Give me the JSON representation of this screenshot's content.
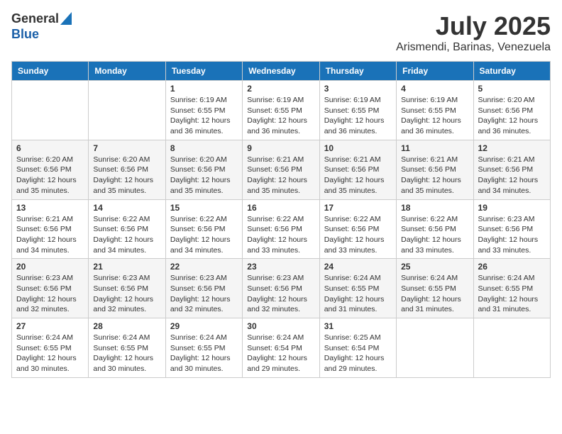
{
  "logo": {
    "general": "General",
    "blue": "Blue"
  },
  "header": {
    "month_year": "July 2025",
    "location": "Arismendi, Barinas, Venezuela"
  },
  "weekdays": [
    "Sunday",
    "Monday",
    "Tuesday",
    "Wednesday",
    "Thursday",
    "Friday",
    "Saturday"
  ],
  "weeks": [
    [
      {
        "day": "",
        "info": ""
      },
      {
        "day": "",
        "info": ""
      },
      {
        "day": "1",
        "info": "Sunrise: 6:19 AM\nSunset: 6:55 PM\nDaylight: 12 hours and 36 minutes."
      },
      {
        "day": "2",
        "info": "Sunrise: 6:19 AM\nSunset: 6:55 PM\nDaylight: 12 hours and 36 minutes."
      },
      {
        "day": "3",
        "info": "Sunrise: 6:19 AM\nSunset: 6:55 PM\nDaylight: 12 hours and 36 minutes."
      },
      {
        "day": "4",
        "info": "Sunrise: 6:19 AM\nSunset: 6:55 PM\nDaylight: 12 hours and 36 minutes."
      },
      {
        "day": "5",
        "info": "Sunrise: 6:20 AM\nSunset: 6:56 PM\nDaylight: 12 hours and 36 minutes."
      }
    ],
    [
      {
        "day": "6",
        "info": "Sunrise: 6:20 AM\nSunset: 6:56 PM\nDaylight: 12 hours and 35 minutes."
      },
      {
        "day": "7",
        "info": "Sunrise: 6:20 AM\nSunset: 6:56 PM\nDaylight: 12 hours and 35 minutes."
      },
      {
        "day": "8",
        "info": "Sunrise: 6:20 AM\nSunset: 6:56 PM\nDaylight: 12 hours and 35 minutes."
      },
      {
        "day": "9",
        "info": "Sunrise: 6:21 AM\nSunset: 6:56 PM\nDaylight: 12 hours and 35 minutes."
      },
      {
        "day": "10",
        "info": "Sunrise: 6:21 AM\nSunset: 6:56 PM\nDaylight: 12 hours and 35 minutes."
      },
      {
        "day": "11",
        "info": "Sunrise: 6:21 AM\nSunset: 6:56 PM\nDaylight: 12 hours and 35 minutes."
      },
      {
        "day": "12",
        "info": "Sunrise: 6:21 AM\nSunset: 6:56 PM\nDaylight: 12 hours and 34 minutes."
      }
    ],
    [
      {
        "day": "13",
        "info": "Sunrise: 6:21 AM\nSunset: 6:56 PM\nDaylight: 12 hours and 34 minutes."
      },
      {
        "day": "14",
        "info": "Sunrise: 6:22 AM\nSunset: 6:56 PM\nDaylight: 12 hours and 34 minutes."
      },
      {
        "day": "15",
        "info": "Sunrise: 6:22 AM\nSunset: 6:56 PM\nDaylight: 12 hours and 34 minutes."
      },
      {
        "day": "16",
        "info": "Sunrise: 6:22 AM\nSunset: 6:56 PM\nDaylight: 12 hours and 33 minutes."
      },
      {
        "day": "17",
        "info": "Sunrise: 6:22 AM\nSunset: 6:56 PM\nDaylight: 12 hours and 33 minutes."
      },
      {
        "day": "18",
        "info": "Sunrise: 6:22 AM\nSunset: 6:56 PM\nDaylight: 12 hours and 33 minutes."
      },
      {
        "day": "19",
        "info": "Sunrise: 6:23 AM\nSunset: 6:56 PM\nDaylight: 12 hours and 33 minutes."
      }
    ],
    [
      {
        "day": "20",
        "info": "Sunrise: 6:23 AM\nSunset: 6:56 PM\nDaylight: 12 hours and 32 minutes."
      },
      {
        "day": "21",
        "info": "Sunrise: 6:23 AM\nSunset: 6:56 PM\nDaylight: 12 hours and 32 minutes."
      },
      {
        "day": "22",
        "info": "Sunrise: 6:23 AM\nSunset: 6:56 PM\nDaylight: 12 hours and 32 minutes."
      },
      {
        "day": "23",
        "info": "Sunrise: 6:23 AM\nSunset: 6:56 PM\nDaylight: 12 hours and 32 minutes."
      },
      {
        "day": "24",
        "info": "Sunrise: 6:24 AM\nSunset: 6:55 PM\nDaylight: 12 hours and 31 minutes."
      },
      {
        "day": "25",
        "info": "Sunrise: 6:24 AM\nSunset: 6:55 PM\nDaylight: 12 hours and 31 minutes."
      },
      {
        "day": "26",
        "info": "Sunrise: 6:24 AM\nSunset: 6:55 PM\nDaylight: 12 hours and 31 minutes."
      }
    ],
    [
      {
        "day": "27",
        "info": "Sunrise: 6:24 AM\nSunset: 6:55 PM\nDaylight: 12 hours and 30 minutes."
      },
      {
        "day": "28",
        "info": "Sunrise: 6:24 AM\nSunset: 6:55 PM\nDaylight: 12 hours and 30 minutes."
      },
      {
        "day": "29",
        "info": "Sunrise: 6:24 AM\nSunset: 6:55 PM\nDaylight: 12 hours and 30 minutes."
      },
      {
        "day": "30",
        "info": "Sunrise: 6:24 AM\nSunset: 6:54 PM\nDaylight: 12 hours and 29 minutes."
      },
      {
        "day": "31",
        "info": "Sunrise: 6:25 AM\nSunset: 6:54 PM\nDaylight: 12 hours and 29 minutes."
      },
      {
        "day": "",
        "info": ""
      },
      {
        "day": "",
        "info": ""
      }
    ]
  ]
}
